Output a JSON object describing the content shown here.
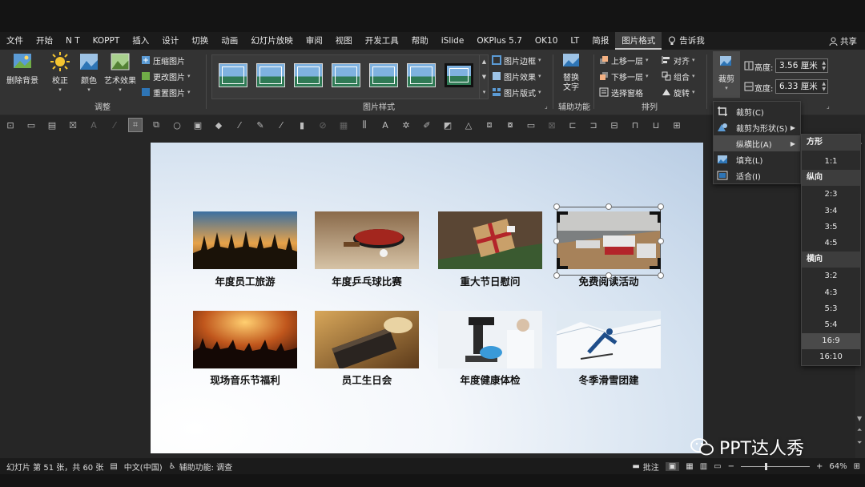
{
  "menubar": {
    "tabs": [
      "文件",
      "开始",
      "N T",
      "KOPPT",
      "插入",
      "设计",
      "切换",
      "动画",
      "幻灯片放映",
      "审阅",
      "视图",
      "开发工具",
      "帮助",
      "iSlide",
      "OKPlus 5.7",
      "OK10",
      "LT",
      "简报",
      "图片格式"
    ],
    "active_tab": "图片格式",
    "tell_me": "告诉我",
    "share": "共享"
  },
  "ribbon": {
    "remove_bg": "删除背景",
    "corrections": "校正",
    "color": "颜色",
    "artistic": "艺术效果",
    "compress": "压缩图片",
    "change": "更改图片",
    "reset": "重置图片",
    "group_adjust": "调整",
    "group_styles": "图片样式",
    "border": "图片边框",
    "effects": "图片效果",
    "layout": "图片版式",
    "alt_text": "替换\n文字",
    "alt_text_l1": "替换",
    "alt_text_l2": "文字",
    "group_access": "辅助功能",
    "bring_forward": "上移一层",
    "send_backward": "下移一层",
    "selection_pane": "选择窗格",
    "align": "对齐",
    "group": "组合",
    "rotate": "旋转",
    "group_arrange": "排列",
    "crop": "裁剪",
    "height_label": "高度:",
    "height_value": "3.56 厘米",
    "width_label": "宽度:",
    "width_value": "6.33 厘米"
  },
  "crop_menu": {
    "items": [
      "裁剪(C)",
      "裁剪为形状(S)",
      "纵横比(A)",
      "填充(L)",
      "适合(I)"
    ]
  },
  "aspect_menu": {
    "h_square": "方形",
    "square": [
      "1:1"
    ],
    "h_portrait": "纵向",
    "portrait": [
      "2:3",
      "3:4",
      "3:5",
      "4:5"
    ],
    "h_landscape": "横向",
    "landscape": [
      "3:2",
      "4:3",
      "5:3",
      "5:4",
      "16:9",
      "16:10"
    ],
    "selected": "16:9"
  },
  "slide": {
    "captions": [
      "年度员工旅游",
      "年度乒乓球比赛",
      "重大节日慰问",
      "免费阅读活动",
      "现场音乐节福利",
      "员工生日会",
      "年度健康体检",
      "冬季滑雪团建"
    ]
  },
  "status": {
    "slide_info": "幻灯片 第 51 张，共 60 张",
    "language": "中文(中国)",
    "accessibility": "辅助功能: 调查",
    "notes": "批注",
    "zoom": "64%"
  },
  "watermark": "PPT达人秀"
}
